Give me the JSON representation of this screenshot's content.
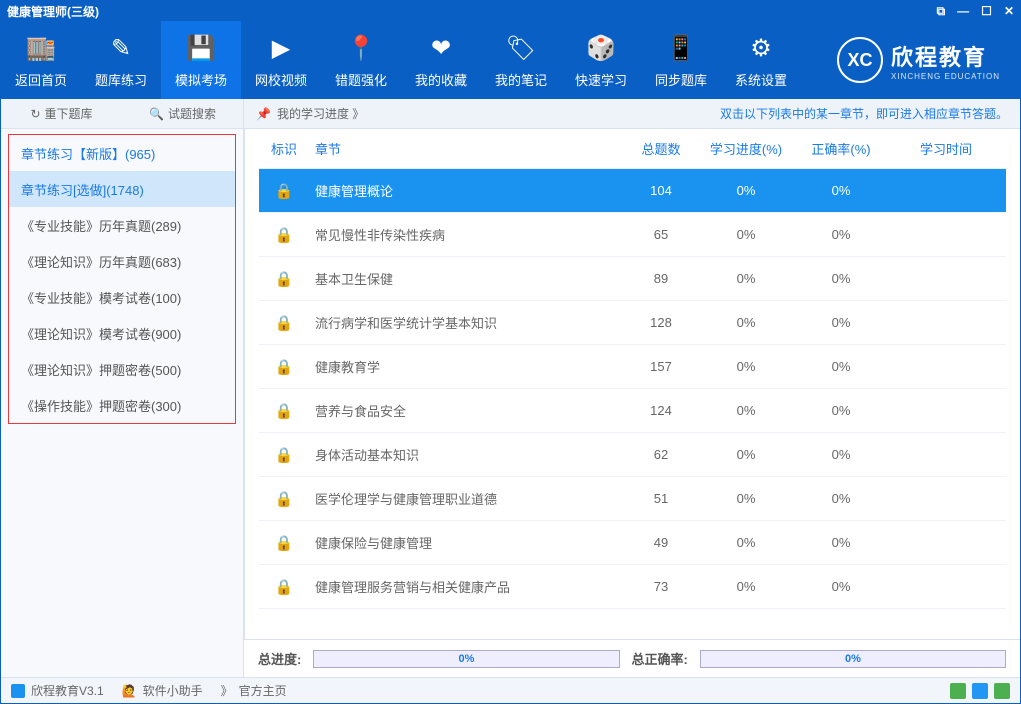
{
  "title": "健康管理师(三级)",
  "window_controls": {
    "restore": "⧉",
    "min": "—",
    "max": "☐",
    "close": "✕"
  },
  "nav": [
    {
      "label": "返回首页",
      "icon": "🏬"
    },
    {
      "label": "题库练习",
      "icon": "✎"
    },
    {
      "label": "模拟考场",
      "icon": "💾"
    },
    {
      "label": "网校视频",
      "icon": "▶"
    },
    {
      "label": "错题强化",
      "icon": "📍"
    },
    {
      "label": "我的收藏",
      "icon": "❤"
    },
    {
      "label": "我的笔记",
      "icon": "🏷"
    },
    {
      "label": "快速学习",
      "icon": "🎲"
    },
    {
      "label": "同步题库",
      "icon": "📱"
    },
    {
      "label": "系统设置",
      "icon": "⚙"
    }
  ],
  "brand_main": "欣程教育",
  "brand_sub": "XINCHENG EDUCATION",
  "brand_logo": "XC",
  "sidebar_tools": {
    "t1": "重下题库",
    "t2": "试题搜索"
  },
  "sidebar": [
    "章节练习【新版】(965)",
    "章节练习[选做](1748)",
    "《专业技能》历年真题(289)",
    "《理论知识》历年真题(683)",
    "《专业技能》模考试卷(100)",
    "《理论知识》模考试卷(900)",
    "《理论知识》押题密卷(500)",
    "《操作技能》押题密卷(300)"
  ],
  "breadcrumb": "我的学习进度 》",
  "hint": "双击以下列表中的某一章节，即可进入相应章节答题。",
  "columns": {
    "c0": "标识",
    "c1": "章节",
    "c2": "总题数",
    "c3": "学习进度(%)",
    "c4": "正确率(%)",
    "c5": "学习时间"
  },
  "rows": [
    {
      "title": "健康管理概论",
      "n": "104",
      "p": "0%",
      "a": "0%"
    },
    {
      "title": "常见慢性非传染性疾病",
      "n": "65",
      "p": "0%",
      "a": "0%"
    },
    {
      "title": "基本卫生保健",
      "n": "89",
      "p": "0%",
      "a": "0%"
    },
    {
      "title": "流行病学和医学统计学基本知识",
      "n": "128",
      "p": "0%",
      "a": "0%"
    },
    {
      "title": "健康教育学",
      "n": "157",
      "p": "0%",
      "a": "0%"
    },
    {
      "title": "营养与食品安全",
      "n": "124",
      "p": "0%",
      "a": "0%"
    },
    {
      "title": "身体活动基本知识",
      "n": "62",
      "p": "0%",
      "a": "0%"
    },
    {
      "title": "医学伦理学与健康管理职业道德",
      "n": "51",
      "p": "0%",
      "a": "0%"
    },
    {
      "title": "健康保险与健康管理",
      "n": "49",
      "p": "0%",
      "a": "0%"
    },
    {
      "title": "健康管理服务营销与相关健康产品",
      "n": "73",
      "p": "0%",
      "a": "0%"
    }
  ],
  "summary": {
    "p_label": "总进度:",
    "p_val": "0%",
    "a_label": "总正确率:",
    "a_val": "0%"
  },
  "status": {
    "app": "欣程教育V3.1",
    "helper": "软件小助手",
    "home": "官方主页",
    "chev": "》"
  },
  "icons": {
    "refresh": "↻",
    "search": "🔍",
    "pin": "📌",
    "lock": "🔒",
    "helper": "🙋"
  }
}
